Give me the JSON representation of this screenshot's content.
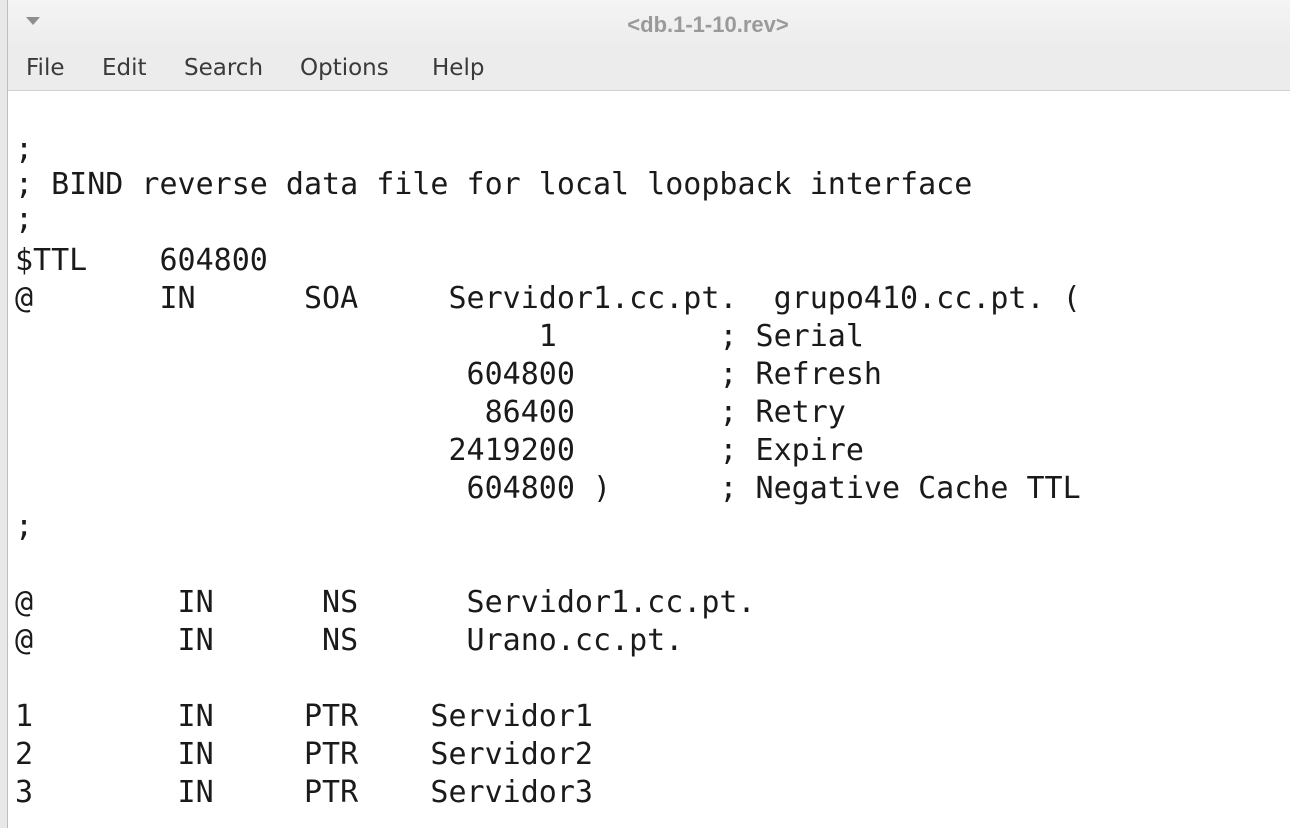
{
  "window": {
    "title": "<db.1-1-10.rev>"
  },
  "menu": {
    "items": [
      "File",
      "Edit",
      "Search",
      "Options",
      "Help"
    ]
  },
  "editor": {
    "lines": [
      ";",
      "; BIND reverse data file for local loopback interface",
      ";",
      "$TTL    604800",
      "@       IN      SOA     Servidor1.cc.pt.  grupo410.cc.pt. (",
      "                             1         ; Serial",
      "                         604800        ; Refresh",
      "                          86400        ; Retry",
      "                        2419200        ; Expire",
      "                         604800 )      ; Negative Cache TTL",
      ";",
      "",
      "@        IN      NS      Servidor1.cc.pt.",
      "@        IN      NS      Urano.cc.pt.",
      "",
      "1        IN     PTR    Servidor1",
      "2        IN     PTR    Servidor2",
      "3        IN     PTR    Servidor3"
    ]
  }
}
